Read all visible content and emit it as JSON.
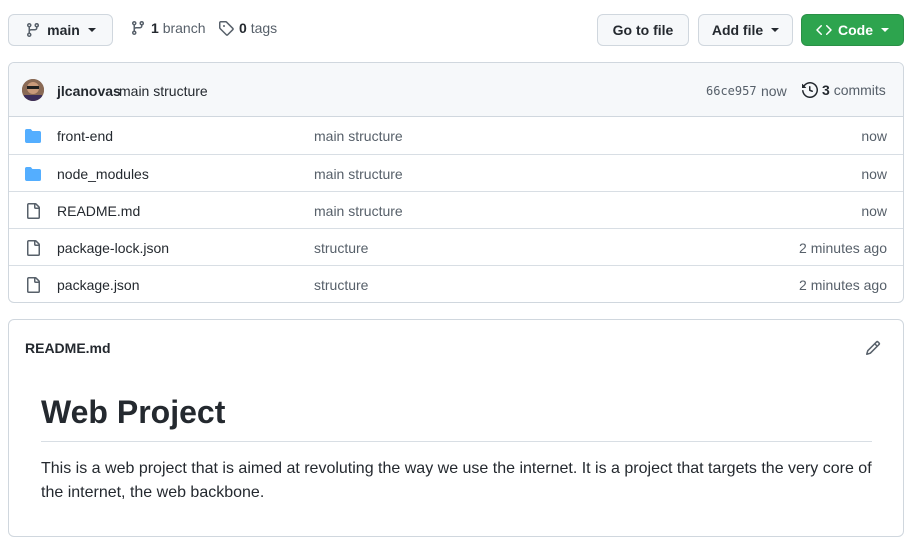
{
  "toolbar": {
    "branch_label": "main",
    "branch_count": "1",
    "branch_text": "branch",
    "tag_count": "0",
    "tag_text": "tags",
    "go_to_file": "Go to file",
    "add_file": "Add file",
    "code": "Code"
  },
  "commit": {
    "author": "jlcanovas",
    "message": "main structure",
    "sha": "66ce957",
    "time": "now",
    "commit_count": "3",
    "commit_text": "commits"
  },
  "files": [
    {
      "type": "folder",
      "name": "front-end",
      "message": "main structure",
      "age": "now"
    },
    {
      "type": "folder",
      "name": "node_modules",
      "message": "main structure",
      "age": "now"
    },
    {
      "type": "file",
      "name": "README.md",
      "message": "main structure",
      "age": "now"
    },
    {
      "type": "file",
      "name": "package-lock.json",
      "message": "structure",
      "age": "2 minutes ago"
    },
    {
      "type": "file",
      "name": "package.json",
      "message": "structure",
      "age": "2 minutes ago"
    }
  ],
  "readme": {
    "filename": "README.md",
    "heading": "Web Project",
    "body": "This is a web project that is aimed at revoluting the way we use the internet. It is a project that targets the very core of the internet, the web backbone."
  },
  "colors": {
    "accent_green": "#2da44e",
    "folder_blue": "#54aeff",
    "muted": "#57606a"
  }
}
